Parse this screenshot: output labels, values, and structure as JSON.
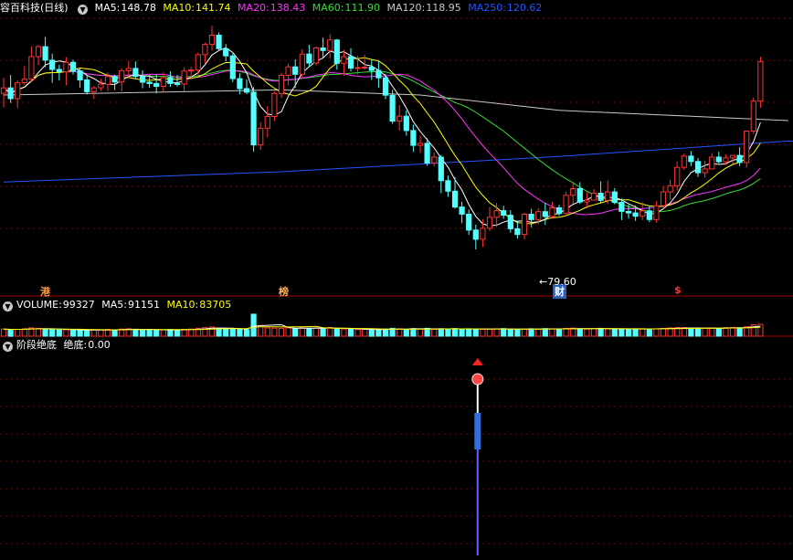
{
  "main": {
    "stock_name": "容百科技",
    "period": "(日线)",
    "ma": [
      {
        "label": "MA5:",
        "value": "148.78",
        "color": "#ffffff"
      },
      {
        "label": "MA10:",
        "value": "141.74",
        "color": "#ffff00"
      },
      {
        "label": "MA20:",
        "value": "138.43",
        "color": "#ff33ff"
      },
      {
        "label": "MA60:",
        "value": "111.90",
        "color": "#33dd33"
      },
      {
        "label": "MA120:",
        "value": "118.95",
        "color": "#c8c8c8"
      },
      {
        "label": "MA250:",
        "value": "120.62",
        "color": "#2255ff"
      }
    ],
    "low_marker": "79.60",
    "markers": [
      "港",
      "榜",
      "财",
      "$"
    ]
  },
  "volume": {
    "label": "VOLUME:",
    "value": "99327",
    "ma5_label": "MA5:",
    "ma5_value": "91151",
    "ma10_label": "MA10:",
    "ma10_value": "83705"
  },
  "indicator": {
    "name": "阶段绝底",
    "series_label": "绝底:",
    "series_value": "0.00"
  },
  "colors": {
    "up": "#ff3333",
    "down": "#54ffff",
    "grid": "#7a0000",
    "separator": "#aa0000",
    "ma5": "#ffffff",
    "ma10": "#ffff00",
    "ma20": "#ff33ff",
    "ma60": "#33dd33",
    "ma120": "#c8c8c8",
    "ma250": "#2255ff"
  },
  "chart_data": {
    "type": "candlestick",
    "price_ylim": [
      70,
      170
    ],
    "candles_ohlc": [
      [
        140.7,
        146.7,
        135.1,
        142.8
      ],
      [
        142.8,
        147.8,
        136.9,
        138.6
      ],
      [
        138.6,
        145.7,
        134.9,
        144.8
      ],
      [
        144.8,
        151.3,
        144.0,
        146.2
      ],
      [
        146.2,
        158.9,
        145.1,
        155.0
      ],
      [
        155.0,
        159.5,
        151.7,
        158.9
      ],
      [
        158.9,
        162.7,
        150.9,
        153.6
      ],
      [
        153.6,
        156.2,
        144.8,
        150.0
      ],
      [
        150.0,
        151.8,
        145.7,
        149.1
      ],
      [
        149.1,
        154.8,
        143.8,
        152.8
      ],
      [
        152.8,
        153.8,
        148.0,
        149.4
      ],
      [
        149.4,
        150.4,
        142.9,
        145.9
      ],
      [
        145.9,
        147.5,
        140.2,
        141.3
      ],
      [
        141.3,
        143.6,
        138.4,
        142.8
      ],
      [
        142.8,
        146.3,
        141.6,
        144.2
      ],
      [
        144.2,
        148.8,
        141.5,
        147.2
      ],
      [
        147.2,
        147.9,
        141.9,
        145.1
      ],
      [
        145.1,
        150.5,
        141.4,
        149.5
      ],
      [
        149.5,
        153.4,
        146.8,
        150.4
      ],
      [
        150.4,
        153.1,
        146.3,
        147.3
      ],
      [
        147.3,
        149.6,
        142.7,
        145.0
      ],
      [
        145.0,
        147.8,
        142.8,
        144.5
      ],
      [
        144.5,
        148.2,
        140.6,
        143.4
      ],
      [
        143.4,
        148.8,
        141.3,
        146.8
      ],
      [
        146.8,
        149.3,
        143.2,
        144.5
      ],
      [
        144.5,
        147.8,
        143.3,
        144.3
      ],
      [
        144.3,
        150.9,
        141.6,
        149.4
      ],
      [
        149.4,
        151.1,
        146.0,
        149.8
      ],
      [
        149.8,
        156.6,
        147.8,
        155.8
      ],
      [
        155.8,
        160.5,
        152.4,
        159.8
      ],
      [
        159.8,
        167.0,
        157.3,
        163.4
      ],
      [
        163.4,
        164.5,
        157.4,
        158.1
      ],
      [
        158.1,
        159.9,
        153.2,
        155.3
      ],
      [
        155.3,
        156.3,
        145.1,
        146.4
      ],
      [
        146.4,
        148.5,
        140.3,
        142.5
      ],
      [
        142.5,
        146.1,
        140.4,
        141.1
      ],
      [
        141.1,
        143.1,
        117.8,
        120.5
      ],
      [
        120.5,
        129.4,
        118.5,
        127.0
      ],
      [
        127.0,
        135.7,
        123.5,
        131.6
      ],
      [
        131.6,
        141.4,
        129.8,
        140.6
      ],
      [
        140.6,
        148.7,
        138.9,
        147.7
      ],
      [
        147.7,
        152.2,
        143.8,
        151.0
      ],
      [
        151.0,
        153.9,
        142.8,
        148.1
      ],
      [
        148.1,
        157.9,
        146.8,
        156.0
      ],
      [
        156.0,
        159.6,
        150.9,
        152.5
      ],
      [
        152.5,
        159.0,
        151.6,
        158.4
      ],
      [
        158.4,
        162.4,
        154.4,
        157.4
      ],
      [
        157.4,
        163.8,
        154.4,
        161.5
      ],
      [
        161.5,
        161.9,
        149.9,
        152.4
      ],
      [
        152.4,
        157.7,
        147.5,
        155.0
      ],
      [
        155.0,
        158.3,
        149.2,
        150.5
      ],
      [
        150.5,
        155.4,
        148.1,
        150.7
      ],
      [
        150.7,
        155.8,
        149.9,
        150.9
      ],
      [
        150.9,
        153.8,
        145.9,
        149.6
      ],
      [
        149.6,
        153.3,
        142.8,
        146.7
      ],
      [
        146.7,
        148.3,
        138.4,
        139.9
      ],
      [
        139.9,
        142.0,
        128.7,
        129.8
      ],
      [
        129.8,
        136.1,
        126.1,
        131.7
      ],
      [
        131.7,
        133.9,
        124.1,
        126.1
      ],
      [
        126.1,
        128.4,
        117.8,
        120.3
      ],
      [
        120.3,
        124.1,
        117.3,
        121.1
      ],
      [
        121.1,
        123.1,
        112.3,
        113.4
      ],
      [
        113.4,
        117.6,
        112.1,
        115.7
      ],
      [
        115.7,
        116.6,
        101.6,
        106.5
      ],
      [
        106.5,
        108.5,
        100.2,
        102.4
      ],
      [
        102.4,
        107.9,
        95.6,
        96.2
      ],
      [
        96.2,
        98.3,
        89.9,
        93.4
      ],
      [
        93.4,
        95.2,
        85.3,
        87.2
      ],
      [
        87.2,
        89.3,
        79.6,
        83.6
      ],
      [
        83.6,
        91.5,
        80.6,
        87.9
      ],
      [
        87.9,
        96.3,
        86.8,
        92.2
      ],
      [
        92.2,
        97.8,
        88.4,
        94.8
      ],
      [
        94.8,
        96.7,
        91.6,
        93.0
      ],
      [
        93.0,
        95.0,
        86.2,
        87.7
      ],
      [
        87.7,
        90.5,
        83.9,
        85.5
      ],
      [
        85.5,
        93.9,
        83.5,
        93.4
      ],
      [
        93.4,
        95.5,
        88.3,
        91.3
      ],
      [
        91.3,
        95.8,
        89.5,
        94.4
      ],
      [
        94.4,
        97.9,
        89.2,
        92.5
      ],
      [
        92.5,
        98.3,
        91.6,
        95.9
      ],
      [
        95.9,
        97.1,
        92.8,
        93.7
      ],
      [
        93.7,
        102.2,
        92.7,
        100.8
      ],
      [
        100.8,
        106.2,
        97.5,
        103.4
      ],
      [
        103.4,
        105.9,
        97.4,
        98.2
      ],
      [
        98.2,
        102.0,
        95.7,
        98.9
      ],
      [
        98.9,
        103.2,
        98.7,
        101.6
      ],
      [
        101.6,
        106.2,
        97.8,
        98.8
      ],
      [
        98.8,
        106.6,
        97.4,
        102.1
      ],
      [
        102.1,
        103.6,
        97.3,
        98.0
      ],
      [
        98.0,
        99.6,
        91.1,
        94.5
      ],
      [
        94.5,
        97.1,
        91.7,
        93.9
      ],
      [
        93.9,
        96.8,
        90.8,
        92.6
      ],
      [
        92.6,
        98.1,
        91.1,
        94.7
      ],
      [
        94.7,
        96.6,
        90.3,
        91.3
      ],
      [
        91.3,
        98.5,
        90.1,
        96.7
      ],
      [
        96.7,
        104.4,
        95.5,
        102.1
      ],
      [
        102.1,
        106.8,
        98.9,
        104.5
      ],
      [
        104.5,
        114.0,
        102.8,
        111.7
      ],
      [
        111.7,
        117.1,
        110.7,
        116.1
      ],
      [
        116.1,
        118.1,
        112.2,
        114.0
      ],
      [
        114.0,
        115.3,
        108.0,
        109.6
      ],
      [
        109.6,
        114.4,
        107.6,
        111.1
      ],
      [
        111.1,
        117.3,
        111.0,
        115.7
      ],
      [
        115.7,
        117.8,
        113.3,
        113.9
      ],
      [
        113.9,
        116.8,
        112.6,
        115.4
      ],
      [
        115.4,
        116.6,
        113.0,
        116.4
      ],
      [
        116.4,
        119.6,
        112.2,
        113.6
      ],
      [
        113.6,
        126.0,
        111.6,
        125.9
      ],
      [
        125.9,
        139.0,
        124.8,
        137.6
      ],
      [
        137.6,
        155.0,
        135.0,
        153.0
      ]
    ],
    "ma250": [
      [
        0,
        106
      ],
      [
        40,
        110
      ],
      [
        80,
        116
      ],
      [
        113,
        122
      ],
      [
        120,
        121
      ]
    ],
    "ma120": [
      [
        0,
        140
      ],
      [
        40,
        142
      ],
      [
        60,
        140
      ],
      [
        80,
        134
      ],
      [
        113,
        130
      ]
    ],
    "volume": [
      60,
      55,
      58,
      62,
      70,
      66,
      60,
      55,
      52,
      54,
      56,
      50,
      48,
      52,
      55,
      58,
      54,
      60,
      62,
      58,
      55,
      52,
      50,
      54,
      56,
      52,
      58,
      60,
      66,
      72,
      78,
      68,
      60,
      58,
      56,
      55,
      185,
      90,
      70,
      68,
      66,
      70,
      64,
      72,
      68,
      70,
      66,
      74,
      62,
      60,
      58,
      56,
      58,
      55,
      54,
      60,
      66,
      62,
      58,
      64,
      60,
      66,
      58,
      62,
      60,
      64,
      58,
      62,
      60,
      58,
      60,
      62,
      64,
      58,
      56,
      60,
      62,
      60,
      64,
      62,
      60,
      66,
      68,
      62,
      60,
      64,
      66,
      62,
      60,
      58,
      60,
      62,
      64,
      60,
      62,
      66,
      70,
      74,
      72,
      66,
      64,
      68,
      70,
      66,
      72,
      74,
      70,
      80,
      96,
      99.3
    ],
    "volume_ymax": 200,
    "signal_bar_index": 68
  }
}
